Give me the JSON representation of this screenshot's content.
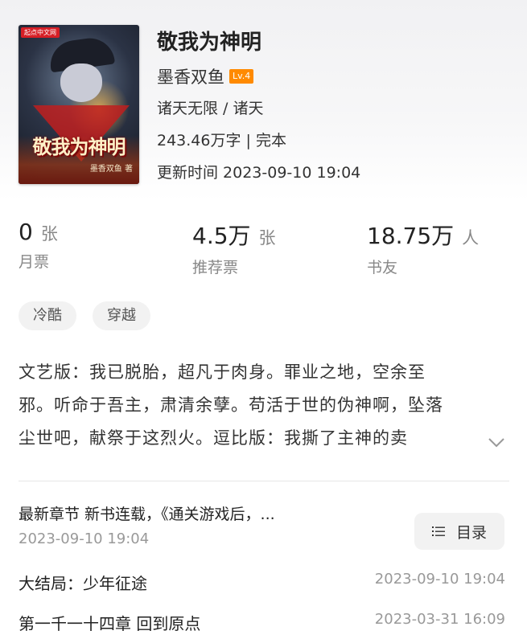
{
  "book": {
    "title": "敬我为神明",
    "author": "墨香双鱼",
    "author_level": "Lv.4",
    "category": "诸天无限 / 诸天",
    "word_count_status": "243.46万字 | 完本",
    "updated": "更新时间 2023-09-10 19:04",
    "cover": {
      "title_text": "敬我为神明",
      "author_text": "墨香双鱼 著",
      "publisher_badge": "起点中文网"
    }
  },
  "stats": [
    {
      "value": "0",
      "unit": "张",
      "label": "月票"
    },
    {
      "value": "4.5万",
      "unit": "张",
      "label": "推荐票"
    },
    {
      "value": "18.75万",
      "unit": "人",
      "label": "书友"
    }
  ],
  "tags": [
    "冷酷",
    "穿越"
  ],
  "description": {
    "line1": "文艺版：我已脱胎，超凡于肉身。罪业之地，空余至",
    "line2": "邪。听命于吾主，肃清余孽。苟活于世的伪神啊，坠落",
    "line3": "尘世吧，献祭于这烈火。逗比版：我撕了主神的卖"
  },
  "latest": {
    "text": "最新章节 新书连载，《通关游戏后，...",
    "time": "2023-09-10 19:04"
  },
  "toc": {
    "label": "目录"
  },
  "chapters": [
    {
      "name": "大结局：少年征途",
      "time": "2023-09-10 19:04"
    },
    {
      "name": "第一千一十四章 回到原点",
      "time": "2023-03-31 16:09"
    }
  ],
  "colors": {
    "level_badge": "#ff8a00",
    "tag_bg": "#f2f2f2",
    "muted_text": "#999999"
  }
}
